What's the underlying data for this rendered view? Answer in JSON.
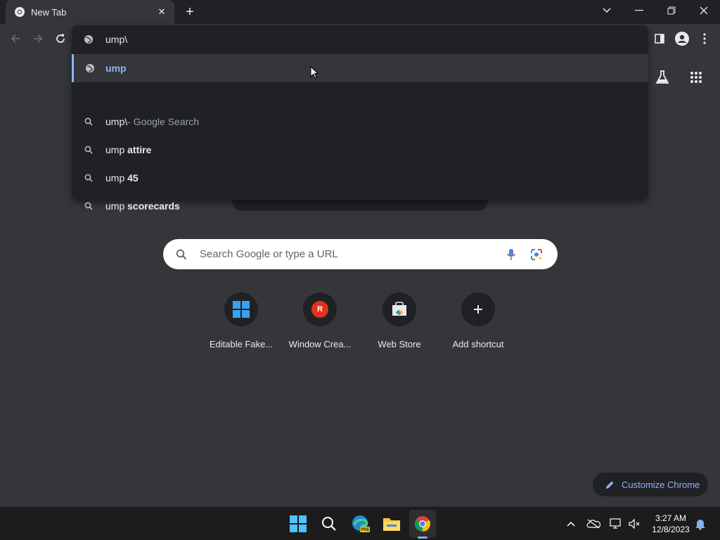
{
  "tab": {
    "title": "New Tab",
    "favicon": "chrome-icon"
  },
  "omnibox": {
    "input_text": "ump\\",
    "suggestions": [
      {
        "type": "url",
        "prefix": "",
        "bold": "ump",
        "suffix": "",
        "icon": "globe-icon"
      },
      {
        "type": "search",
        "prefix": "ump\\",
        "bold": "",
        "suffix": " - Google Search",
        "icon": "search-icon"
      },
      {
        "type": "search",
        "prefix": "ump ",
        "bold": "attire",
        "suffix": "",
        "icon": "search-icon"
      },
      {
        "type": "search",
        "prefix": "ump ",
        "bold": "45",
        "suffix": "",
        "icon": "search-icon"
      },
      {
        "type": "search",
        "prefix": "ump ",
        "bold": "scorecards",
        "suffix": "",
        "icon": "search-icon"
      }
    ]
  },
  "ntp": {
    "search_placeholder": "Search Google or type a URL",
    "shortcuts": [
      {
        "label": "Editable Fake...",
        "icon": "windows-icon"
      },
      {
        "label": "Window Crea...",
        "icon": "r-badge-icon",
        "badge": "R"
      },
      {
        "label": "Web Store",
        "icon": "webstore-icon"
      },
      {
        "label": "Add shortcut",
        "icon": "plus-icon"
      }
    ],
    "customize_label": "Customize Chrome"
  },
  "taskbar": {
    "time": "3:27 AM",
    "date": "12/8/2023",
    "edge_badge": "PRE"
  },
  "colors": {
    "accent": "#8ab4f8",
    "background": "#35363a",
    "dark": "#202124"
  }
}
